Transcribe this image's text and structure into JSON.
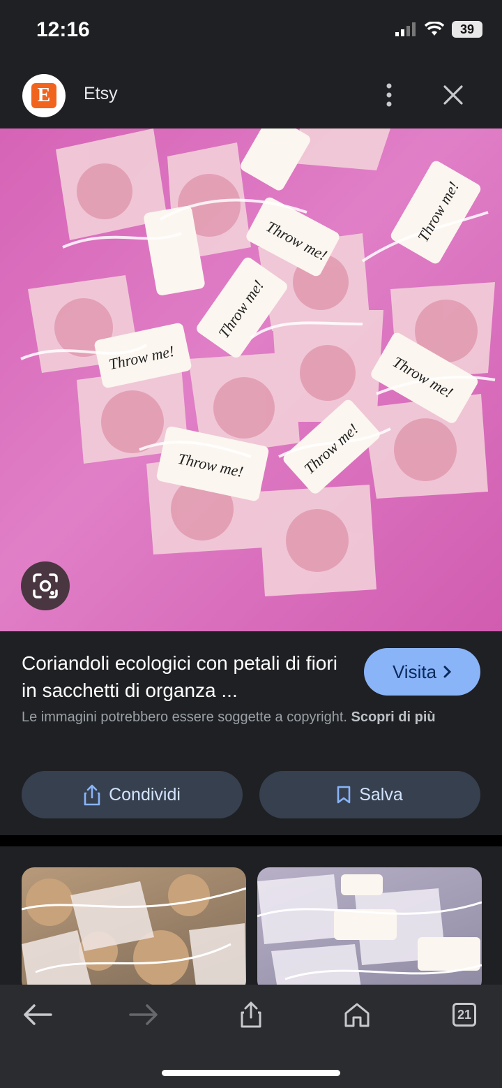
{
  "status": {
    "time": "12:16",
    "battery": "39"
  },
  "header": {
    "site": "Etsy",
    "logo_letter": "E"
  },
  "image": {
    "tag_text": "Throw me!"
  },
  "result": {
    "title": "Coriandoli ecologici con petali di fiori in sacchetti di organza ...",
    "visit_label": "Visita",
    "copyright_text": "Le immagini potrebbero essere soggette a copyright.",
    "learn_more": "Scopri di più"
  },
  "actions": {
    "share_label": "Condividi",
    "save_label": "Salva"
  },
  "bottom": {
    "tab_count": "21"
  },
  "colors": {
    "accent": "#8ab4f8",
    "brand": "#f1641e",
    "background": "#1f2023",
    "button": "#36404f"
  }
}
